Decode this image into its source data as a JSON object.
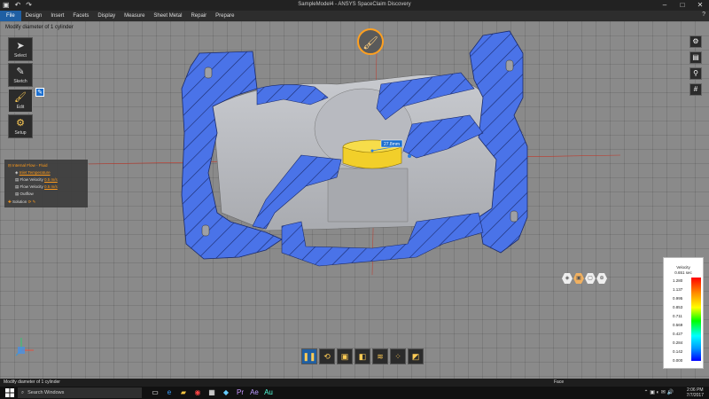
{
  "window": {
    "title": "SampleModel4 - ANSYS SpaceClaim Discovery",
    "controls": [
      "–",
      "□",
      "✕"
    ]
  },
  "menu": {
    "items": [
      "File",
      "Design",
      "Insert",
      "Facets",
      "Display",
      "Measure",
      "Sheet Metal",
      "Repair",
      "Prepare"
    ]
  },
  "hint": "Modify diameter of 1 cylinder",
  "tools": [
    {
      "label": "Select",
      "icon": "cursor-icon"
    },
    {
      "label": "Sketch",
      "icon": "pencil-icon"
    },
    {
      "label": "Edit",
      "icon": "brush-icon"
    },
    {
      "label": "Setup",
      "icon": "setup-icon"
    }
  ],
  "tree": {
    "root": "Internal Flow - Fluid",
    "items": [
      {
        "text": "Inlet Temperature",
        "link": true
      },
      {
        "text": "Flow Velocity",
        "value": "0.5 m/s"
      },
      {
        "text": "Flow Velocity",
        "value": "0.5 m/s"
      },
      {
        "text": "Outflow"
      }
    ],
    "solution": "Solution"
  },
  "dimension_label": "27.8mm",
  "legend": {
    "title": "Velocity",
    "unit": "0.651 sec",
    "ticks": [
      "1.280",
      "1.137",
      "0.995",
      "0.853",
      "0.711",
      "0.569",
      "0.427",
      "0.284",
      "0.142",
      "0.000"
    ],
    "colors": [
      "#ff0000",
      "#ff8800",
      "#ffff00",
      "#00ff00",
      "#00ffff",
      "#0099ff",
      "#0000ff"
    ]
  },
  "statusbar": {
    "message": "Modify diameter of 1 cylinder",
    "mode": "Face"
  },
  "taskbar": {
    "search_placeholder": "Search Windows",
    "time": "2:06 PM",
    "date": "7/7/2017"
  },
  "colors": {
    "section": "#4a73e8",
    "body": "#b5b7bc",
    "highlight": "#f2cf2a",
    "viewport": "#8a8a8a",
    "accent": "#1f5fa3"
  }
}
